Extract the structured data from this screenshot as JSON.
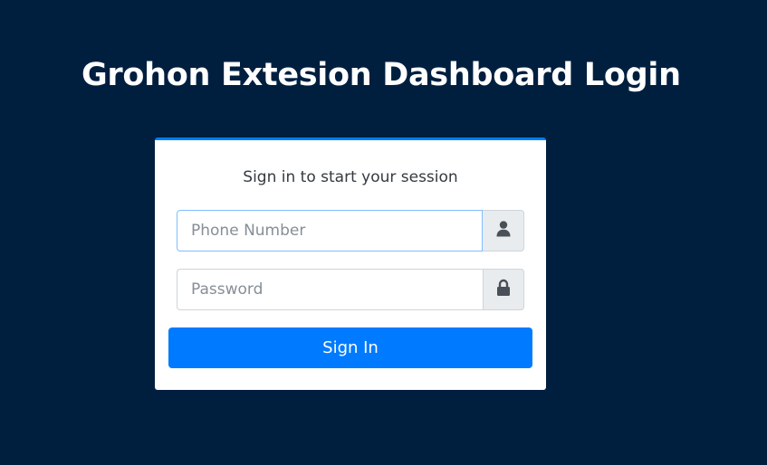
{
  "page": {
    "title": "Grohon Extesion Dashboard Login"
  },
  "card": {
    "message": "Sign in to start your session",
    "phone": {
      "placeholder": "Phone Number",
      "icon": "user-icon"
    },
    "password": {
      "placeholder": "Password",
      "icon": "lock-icon"
    },
    "submit_label": "Sign In"
  },
  "colors": {
    "background": "#001f3f",
    "accent": "#007bff",
    "card": "#ffffff",
    "addon": "#e9ecef",
    "icon": "#495057"
  }
}
